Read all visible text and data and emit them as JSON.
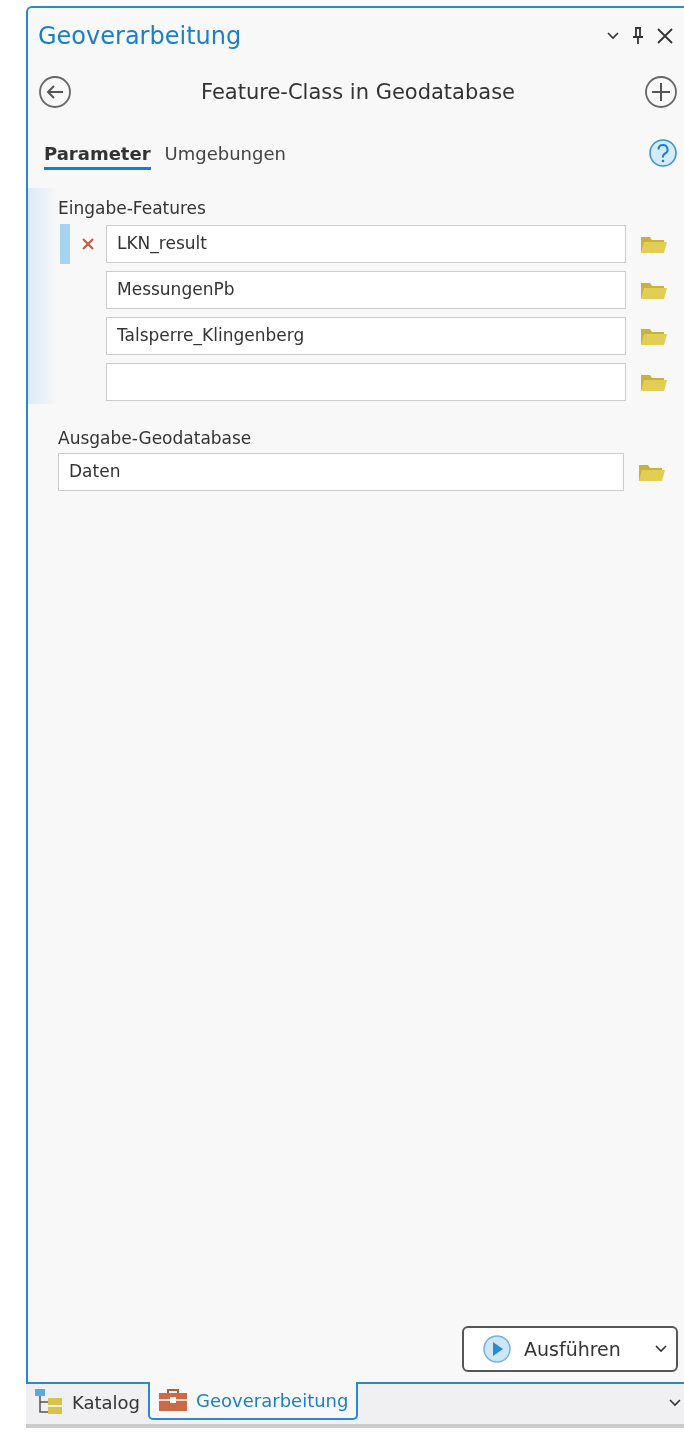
{
  "window": {
    "title": "Geoverarbeitung"
  },
  "tool": {
    "title": "Feature-Class in Geodatabase"
  },
  "tabs": [
    {
      "label": "Parameter",
      "selected": true
    },
    {
      "label": "Umgebungen",
      "selected": false
    }
  ],
  "parameters": {
    "input": {
      "label": "Eingabe-Features",
      "rows": [
        {
          "value": "LKN_result",
          "focused": true
        },
        {
          "value": "MessungenPb",
          "focused": false
        },
        {
          "value": "Talsperre_Klingenberg",
          "focused": false
        },
        {
          "focused": false
        }
      ]
    },
    "output": {
      "label": "Ausgabe-Geodatabase",
      "value": "Daten"
    }
  },
  "run_button": {
    "label": "Ausführen"
  },
  "dock_tabs": [
    {
      "label": "Katalog",
      "kind": "catalog",
      "selected": false
    },
    {
      "label": "Geoverarbeitung",
      "kind": "toolbox",
      "selected": true
    }
  ]
}
